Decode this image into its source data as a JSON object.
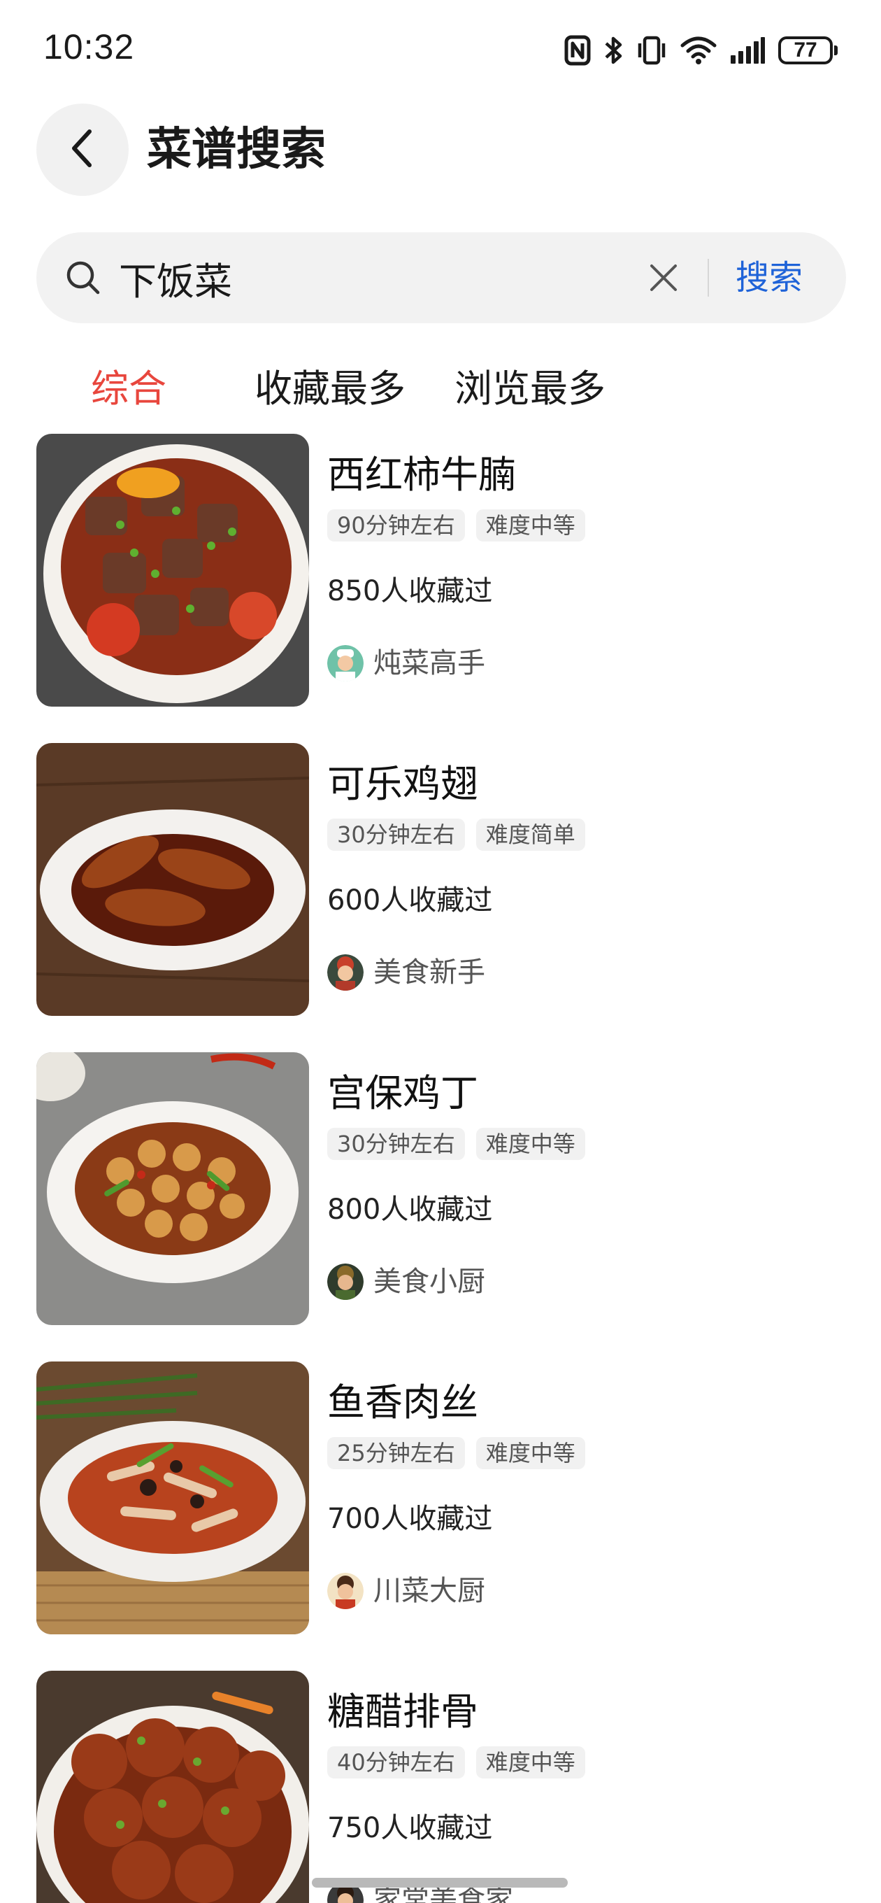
{
  "status_bar": {
    "time": "10:32",
    "battery": "77",
    "icons": [
      "nfc-icon",
      "bluetooth-icon",
      "vibrate-icon",
      "wifi-icon",
      "signal-icon",
      "battery-icon"
    ]
  },
  "header": {
    "title": "菜谱搜索",
    "back_icon": "chevron-left-icon"
  },
  "search": {
    "value": "下饭菜",
    "button_label": "搜索",
    "accent_color": "#1f63d8"
  },
  "tabs": [
    {
      "label": "综合",
      "active": true
    },
    {
      "label": "收藏最多",
      "active": false
    },
    {
      "label": "浏览最多",
      "active": false
    }
  ],
  "active_tab_color": "#e8463d",
  "recipes": [
    {
      "name": "西红柿牛腩",
      "time": "90分钟左右",
      "difficulty": "难度中等",
      "saves": "850人收藏过",
      "author": "炖菜高手"
    },
    {
      "name": "可乐鸡翅",
      "time": "30分钟左右",
      "difficulty": "难度简单",
      "saves": "600人收藏过",
      "author": "美食新手"
    },
    {
      "name": "宫保鸡丁",
      "time": "30分钟左右",
      "difficulty": "难度中等",
      "saves": "800人收藏过",
      "author": "美食小厨"
    },
    {
      "name": "鱼香肉丝",
      "time": "25分钟左右",
      "difficulty": "难度中等",
      "saves": "700人收藏过",
      "author": "川菜大厨"
    },
    {
      "name": "糖醋排骨",
      "time": "40分钟左右",
      "difficulty": "难度中等",
      "saves": "750人收藏过",
      "author": "家常美食家"
    }
  ]
}
